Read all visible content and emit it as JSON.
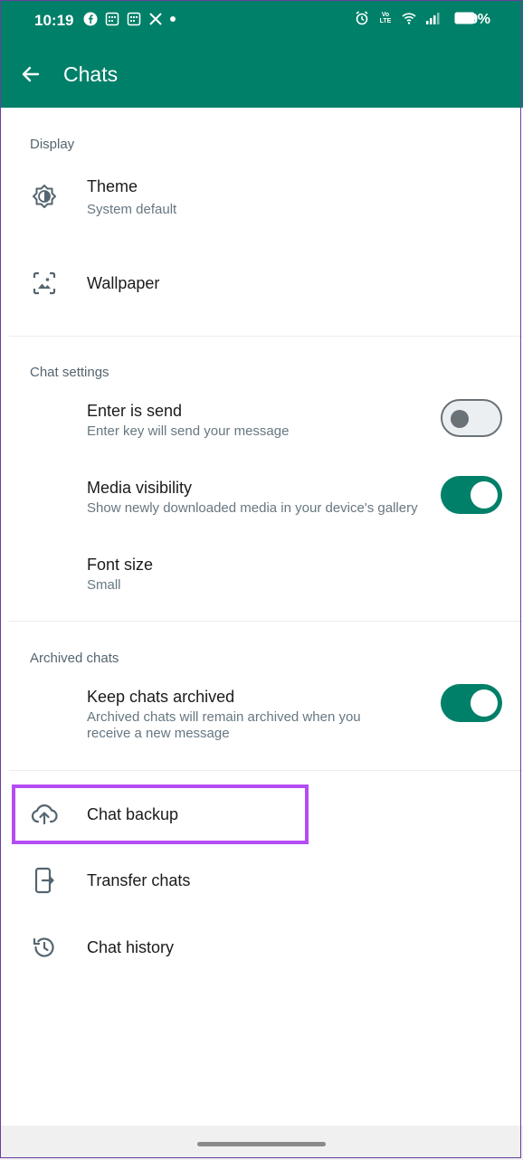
{
  "status_bar": {
    "time": "10:19",
    "battery": "98%",
    "network_label": "Vo LTE"
  },
  "header": {
    "title": "Chats",
    "back_icon": "arrow-left-icon"
  },
  "sections": {
    "display": {
      "label": "Display",
      "theme_title": "Theme",
      "theme_sub": "System default",
      "wallpaper_title": "Wallpaper"
    },
    "chat_settings": {
      "label": "Chat settings",
      "enter_title": "Enter is send",
      "enter_sub": "Enter key will send your message",
      "enter_toggle": false,
      "media_title": "Media visibility",
      "media_sub": "Show newly downloaded media in your device's gallery",
      "media_toggle": true,
      "font_title": "Font size",
      "font_sub": "Small"
    },
    "archived": {
      "label": "Archived chats",
      "keep_title": "Keep chats archived",
      "keep_sub_line1": "Archived chats will remain archived when you",
      "keep_sub_line2": "receive a new message",
      "keep_toggle": true
    },
    "other": {
      "backup_title": "Chat backup",
      "transfer_title": "Transfer chats",
      "history_title": "Chat history"
    }
  },
  "colors": {
    "appbar": "#008069",
    "toggle_on": "#008069",
    "highlight": "#b44cf5"
  }
}
